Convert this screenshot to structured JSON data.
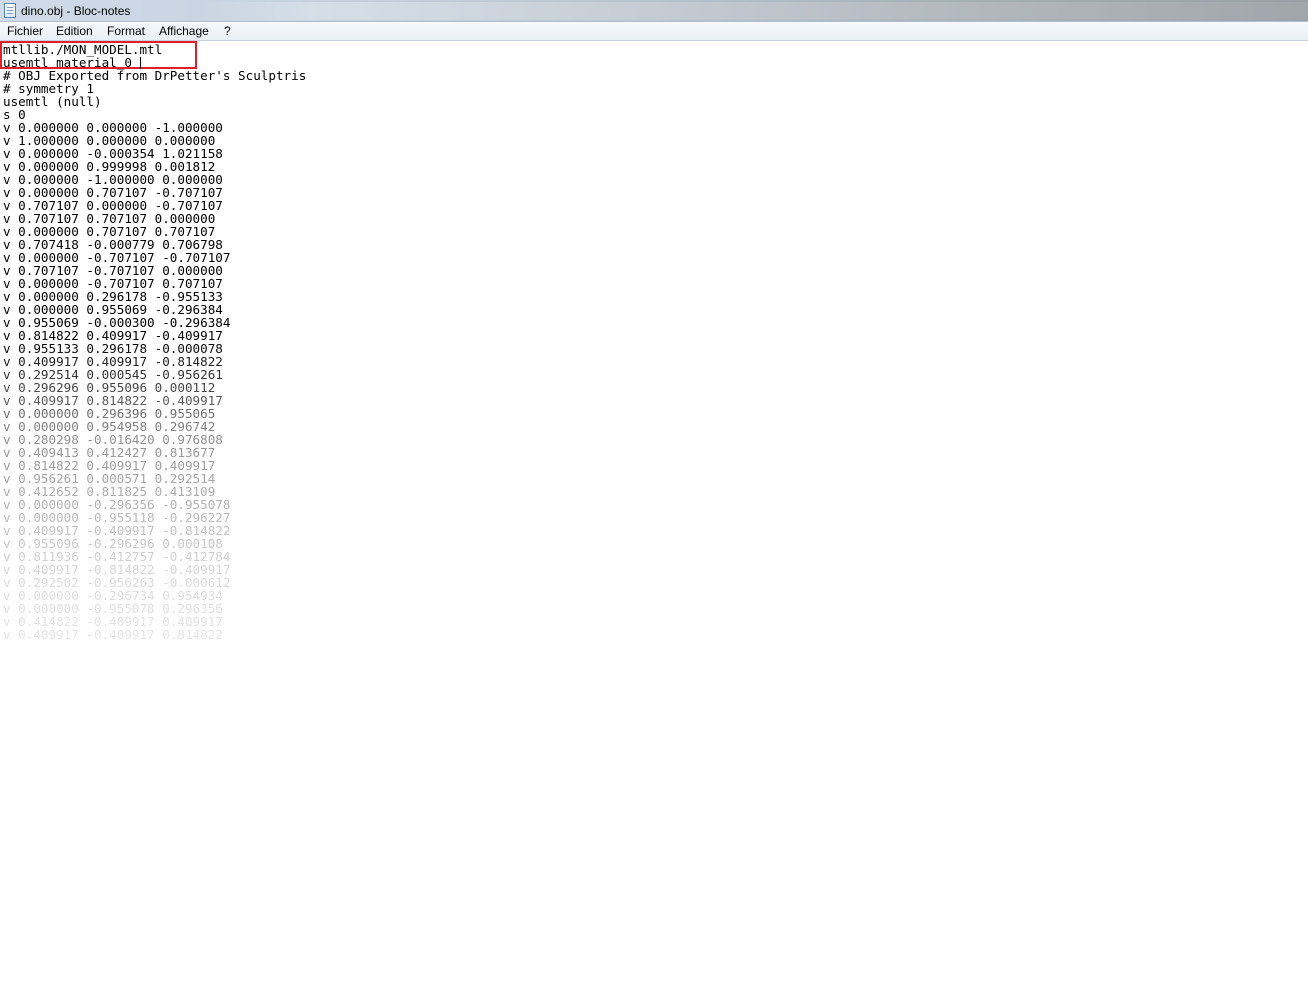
{
  "window": {
    "title": "dino.obj - Bloc-notes",
    "icon": "notepad-icon"
  },
  "menu": {
    "items": [
      {
        "label": "Fichier"
      },
      {
        "label": "Edition"
      },
      {
        "label": "Format"
      },
      {
        "label": "Affichage"
      },
      {
        "label": "?"
      }
    ]
  },
  "annotation": {
    "highlight_color": "#e0202a"
  },
  "editor": {
    "lines": [
      "mtllib./MON_MODEL.mtl",
      "usemtl material_0",
      "# OBJ Exported from DrPetter's Sculptris",
      "# symmetry 1",
      "usemtl (null)",
      "s 0",
      "v 0.000000 0.000000 -1.000000",
      "v 1.000000 0.000000 0.000000",
      "v 0.000000 -0.000354 1.021158",
      "v 0.000000 0.999998 0.001812",
      "v 0.000000 -1.000000 0.000000",
      "v 0.000000 0.707107 -0.707107",
      "v 0.707107 0.000000 -0.707107",
      "v 0.707107 0.707107 0.000000",
      "v 0.000000 0.707107 0.707107",
      "v 0.707418 -0.000779 0.706798",
      "v 0.000000 -0.707107 -0.707107",
      "v 0.707107 -0.707107 0.000000",
      "v 0.000000 -0.707107 0.707107",
      "v 0.000000 0.296178 -0.955133",
      "v 0.000000 0.955069 -0.296384",
      "v 0.955069 -0.000300 -0.296384",
      "v 0.814822 0.409917 -0.409917",
      "v 0.955133 0.296178 -0.000078",
      "v 0.409917 0.409917 -0.814822",
      "v 0.292514 0.000545 -0.956261",
      "v 0.296296 0.955096 0.000112",
      "v 0.409917 0.814822 -0.409917",
      "v 0.000000 0.296396 0.955065",
      "v 0.000000 0.954958 0.296742",
      "v 0.280298 -0.016420 0.976808",
      "v 0.409413 0.412427 0.813677",
      "v 0.814822 0.409917 0.409917",
      "v 0.956261 0.000571 0.292514",
      "v 0.412652 0.811825 0.413109",
      "v 0.000000 -0.296356 -0.955078",
      "v 0.000000 -0.955118 -0.296227",
      "v 0.409917 -0.409917 -0.814822",
      "v 0.955096 -0.296296 0.000108",
      "v 0.811936 -0.412757 -0.412784",
      "v 0.409917 -0.814822 -0.409917",
      "v 0.292502 -0.956263 -0.000612",
      "v 0.000000 -0.296734 0.954934",
      "v 0.000000 -0.955078 0.296356",
      "v 0.414822 -0.409917 0.409917",
      "v 0.409917 -0.409917 0.814822"
    ]
  }
}
